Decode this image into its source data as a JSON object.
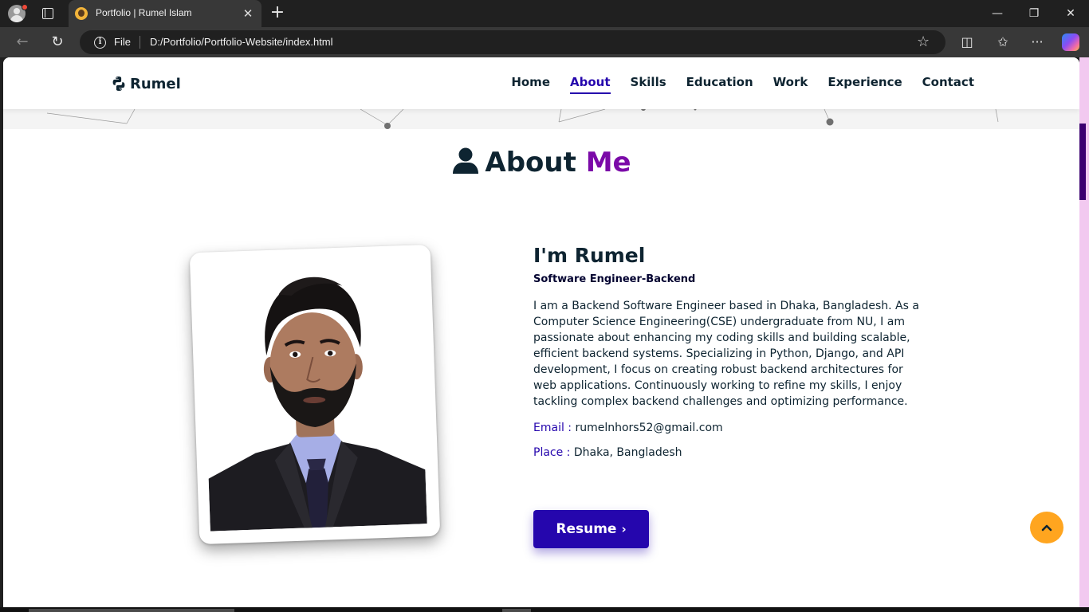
{
  "browser": {
    "tab_title": "Portfolio | Rumel Islam",
    "tab_close": "✕",
    "new_tab": "+",
    "window_minimize": "—",
    "window_restore": "❐",
    "window_close": "✕",
    "address_scheme": "File",
    "address_url": "D:/Portfolio/Portfolio-Website/index.html",
    "icons": {
      "profile": "profile-avatar-icon",
      "tab_actions": "tab-actions-icon",
      "favicon": "favicon-icon",
      "back": "back-arrow-icon",
      "reload": "reload-icon",
      "info": "info-icon",
      "favorite": "star-icon",
      "split_screen": "split-screen-icon",
      "favorites": "favorites-icon",
      "more": "more-icon",
      "copilot": "copilot-icon"
    },
    "glyphs": {
      "back": "←",
      "reload": "↻",
      "info": "i",
      "star": "☆",
      "split": "◫",
      "favorites": "✩",
      "more": "···"
    }
  },
  "header": {
    "logo_text": "Rumel",
    "nav": [
      {
        "label": "Home",
        "active": false
      },
      {
        "label": "About",
        "active": true
      },
      {
        "label": "Skills",
        "active": false
      },
      {
        "label": "Education",
        "active": false
      },
      {
        "label": "Work",
        "active": false
      },
      {
        "label": "Experience",
        "active": false
      },
      {
        "label": "Contact",
        "active": false
      }
    ]
  },
  "about": {
    "title_main": "About",
    "title_accent": "Me",
    "name": "I'm Rumel",
    "role": "Software Engineer-Backend",
    "description": "I am a Backend Software Engineer based in Dhaka, Bangladesh. As a Computer Science Engineering(CSE) undergraduate from NU, I am passionate about enhancing my coding skills and building scalable, efficient backend systems. Specializing in Python, Django, and API development, I focus on creating robust backend architectures for web applications. Continuously working to refine my skills, I enjoy tackling complex backend challenges and optimizing performance.",
    "email_label": "Email :",
    "email_value": "rumelnhors52@gmail.com",
    "place_label": "Place :",
    "place_value": "Dhaka, Bangladesh",
    "resume_label": "Resume",
    "resume_chevron": "›"
  },
  "colors": {
    "primary": "#2506ad",
    "accent": "#7b0aa8",
    "text_dark": "#0e2431",
    "scroll_button": "#ffa51f"
  }
}
